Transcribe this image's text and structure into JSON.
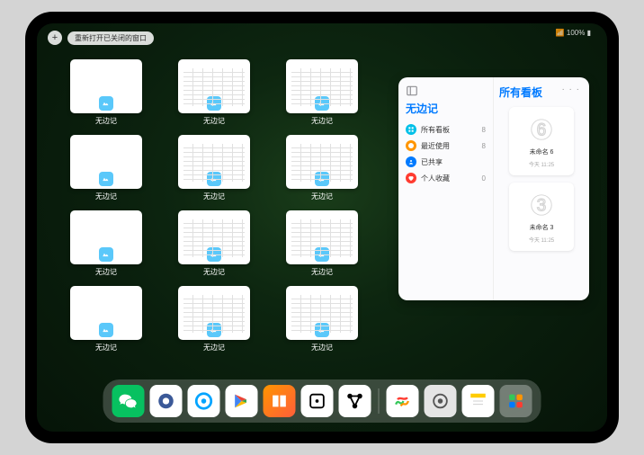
{
  "status": "📶 100% ▮",
  "topbar": {
    "plus": "+",
    "reopen": "重新打开已关闭的窗口"
  },
  "window_label": "无边记",
  "windows": [
    {
      "t": "blank"
    },
    {
      "t": "cal"
    },
    {
      "t": "cal"
    },
    {
      "t": "blank"
    },
    {
      "t": "cal"
    },
    {
      "t": "cal"
    },
    {
      "t": "blank"
    },
    {
      "t": "cal"
    },
    {
      "t": "cal"
    },
    {
      "t": "blank"
    },
    {
      "t": "cal"
    },
    {
      "t": "cal"
    }
  ],
  "popup": {
    "left_title": "无边记",
    "right_title": "所有看板",
    "dots": "· · ·",
    "items": [
      {
        "icon": "grid",
        "color": "#00c0e8",
        "label": "所有看板",
        "count": "8"
      },
      {
        "icon": "clock",
        "color": "#ff9500",
        "label": "最近使用",
        "count": "8"
      },
      {
        "icon": "people",
        "color": "#007aff",
        "label": "已共享",
        "count": ""
      },
      {
        "icon": "heart",
        "color": "#ff3b30",
        "label": "个人收藏",
        "count": "0"
      }
    ],
    "boards": [
      {
        "glyph": "6",
        "name": "未命名 6",
        "time": "今天 11:25"
      },
      {
        "glyph": "3",
        "name": "未命名 3",
        "time": "今天 11:25"
      }
    ]
  },
  "dock": [
    {
      "n": "wechat",
      "bg": "#07c160"
    },
    {
      "n": "quark",
      "bg": "#fff"
    },
    {
      "n": "qqbrowser",
      "bg": "#fff"
    },
    {
      "n": "play",
      "bg": "#fff"
    },
    {
      "n": "books",
      "bg": "linear-gradient(135deg,#ff9500,#ff5e3a)"
    },
    {
      "n": "dice",
      "bg": "#fff"
    },
    {
      "n": "graph",
      "bg": "#fff"
    },
    {
      "n": "sep"
    },
    {
      "n": "freeform",
      "bg": "#fff"
    },
    {
      "n": "settings",
      "bg": "#e5e5e5"
    },
    {
      "n": "notes",
      "bg": "#fff"
    },
    {
      "n": "appgroup",
      "bg": "rgba(255,255,255,.3)"
    }
  ]
}
